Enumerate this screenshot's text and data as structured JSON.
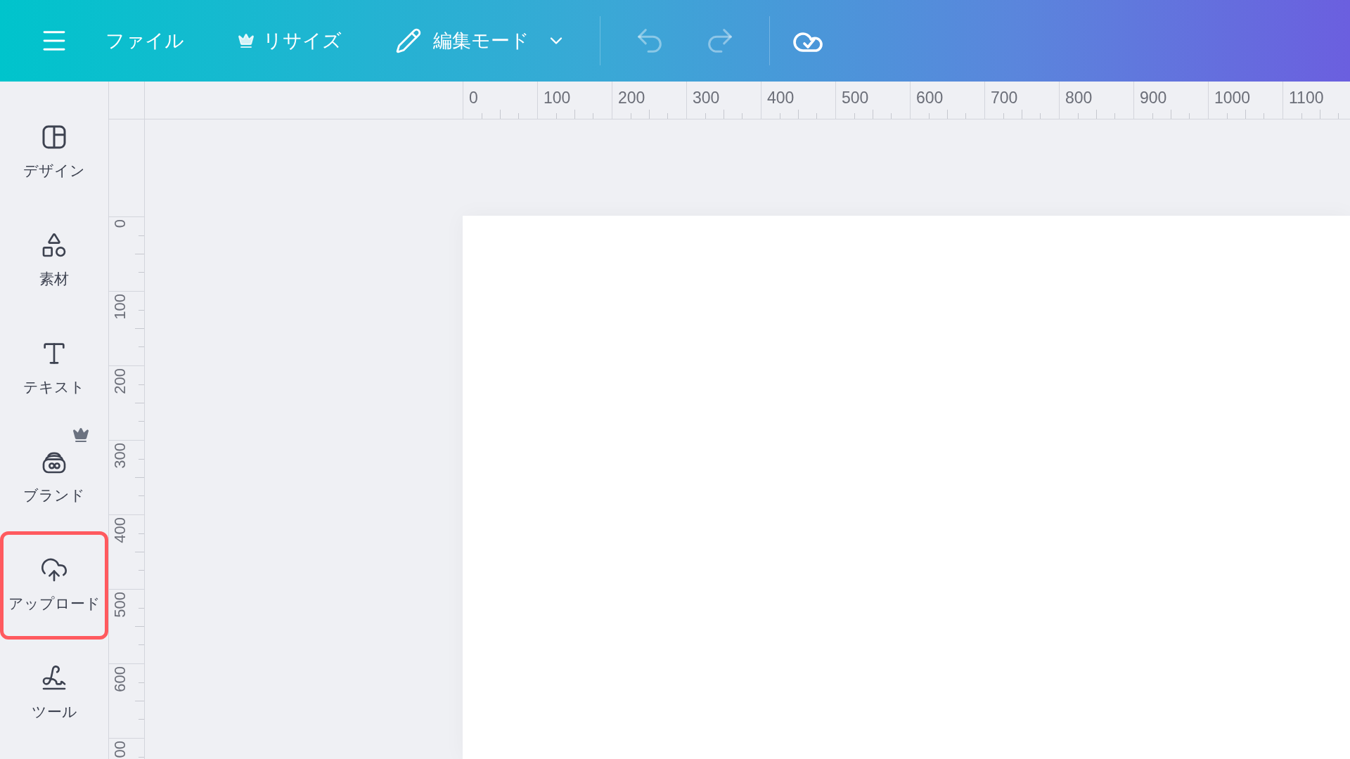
{
  "toolbar": {
    "menu_items": [
      {
        "kind": "text",
        "label": "ファイル"
      },
      {
        "kind": "crown",
        "label": "リサイズ"
      },
      {
        "kind": "dropdown",
        "label": "編集モード"
      }
    ],
    "history": [
      {
        "kind": "undo",
        "disabled": true
      },
      {
        "kind": "redo",
        "disabled": true
      }
    ]
  },
  "sidebar": {
    "items": [
      {
        "kind": "layout",
        "label": "デザイン",
        "selected": false,
        "premium": false
      },
      {
        "kind": "shapes",
        "label": "素材",
        "selected": false,
        "premium": false
      },
      {
        "kind": "text",
        "label": "テキスト",
        "selected": false,
        "premium": false
      },
      {
        "kind": "brand",
        "label": "ブランド",
        "selected": false,
        "premium": true
      },
      {
        "kind": "upload",
        "label": "アップロード",
        "selected": true,
        "premium": false
      },
      {
        "kind": "tools",
        "label": "ツール",
        "selected": false,
        "premium": false
      }
    ]
  },
  "rulers": {
    "horizontal": [
      "0",
      "100",
      "200",
      "300",
      "400",
      "500",
      "600",
      "700",
      "800",
      "900",
      "1000",
      "1100"
    ],
    "vertical": [
      "0",
      "100",
      "200",
      "300",
      "400",
      "500",
      "600",
      "00"
    ]
  }
}
